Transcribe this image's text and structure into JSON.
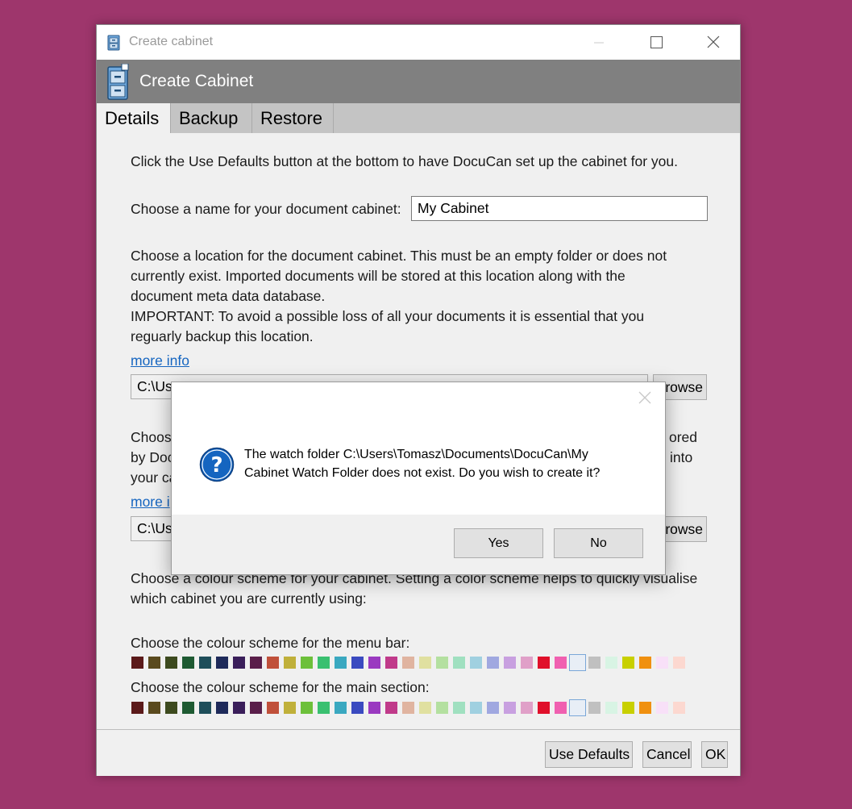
{
  "window": {
    "title": "Create cabinet",
    "header_title": "Create Cabinet"
  },
  "tabs": [
    {
      "label": "Details",
      "active": true
    },
    {
      "label": "Backup",
      "active": false
    },
    {
      "label": "Restore",
      "active": false
    }
  ],
  "details": {
    "intro": "Click the Use Defaults button at the bottom to have DocuCan set up the cabinet for you.",
    "name_label": "Choose a name for your document cabinet:",
    "name_value": "My Cabinet",
    "location_lines": [
      "Choose a location for the document cabinet. This must be an empty folder or does not",
      "currently exist. Imported documents will be stored at this location along with the",
      "document meta data database.",
      "IMPORTANT: To avoid a possible loss of all your documents it is essential that you",
      "reguarly backup this location."
    ],
    "more_info_1": "more info",
    "location_path_visible": "C:\\Use",
    "browse_1": "rowse",
    "watch_lines": [
      {
        "left": "Choos",
        "right": "ored"
      },
      {
        "left": "by Doc",
        "right": "into"
      },
      {
        "left": "your ca",
        "right": ""
      }
    ],
    "more_info_2": "more i",
    "watch_path_visible": "C:\\Use",
    "browse_2": "rowse",
    "colour_lines": [
      "Choose a colour scheme for your cabinet. Setting a color scheme helps to quickly visualise",
      "which cabinet you are currently using:"
    ],
    "menu_bar_label": "Choose the colour scheme for the menu bar:",
    "main_section_label": "Choose the colour scheme for the main section:",
    "swatch_colors": [
      "#5b1a1a",
      "#5a4a1e",
      "#3d4a1e",
      "#1e5a32",
      "#1e4e5a",
      "#1e2a5a",
      "#3a1e5a",
      "#5a1e4a",
      "#c0503a",
      "#c0b03a",
      "#6cc03a",
      "#3ac070",
      "#3aa8c0",
      "#3a4ac0",
      "#9a3ac0",
      "#c03a8a",
      "#e0b4a0",
      "#e0e0a0",
      "#b4e0a0",
      "#a0e0c0",
      "#a0d0e0",
      "#a0a8e0",
      "#c8a0e0",
      "#e0a0c8",
      "#e0102a",
      "#f060b0",
      "#e8eef6",
      "#c0c0c0",
      "#d8f4e4",
      "#c8d000",
      "#f09010",
      "#f8e0f8",
      "#fcd8d0"
    ],
    "selected_swatch_index": 26
  },
  "footer": {
    "use_defaults": "Use Defaults",
    "cancel": "Cancel",
    "ok": "OK"
  },
  "dialog": {
    "message_line1": "The watch folder C:\\Users\\Tomasz\\Documents\\DocuCan\\My",
    "message_line2": "Cabinet Watch Folder does not exist. Do you wish to create it?",
    "yes": "Yes",
    "no": "No"
  }
}
